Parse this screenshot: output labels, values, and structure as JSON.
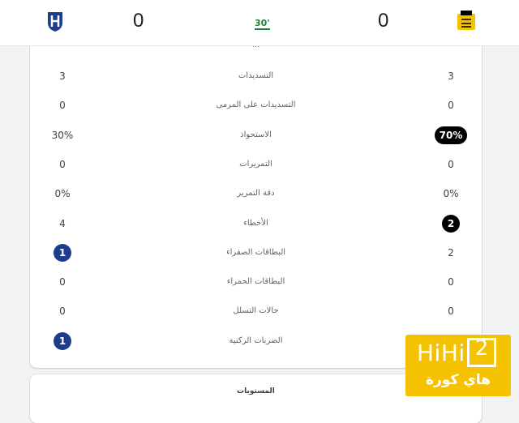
{
  "match": {
    "home_score": "0",
    "away_score": "0",
    "minute": "30'"
  },
  "partial_label": "...",
  "stats": [
    {
      "label": "التسديدات",
      "left": "3",
      "right": "3",
      "left_style": "plain",
      "right_style": "plain"
    },
    {
      "label": "التسديدات على المرمى",
      "left": "0",
      "right": "0",
      "left_style": "plain",
      "right_style": "plain"
    },
    {
      "label": "الاستحواذ",
      "left": "30%",
      "right": "70%",
      "left_style": "plain",
      "right_style": "black"
    },
    {
      "label": "التمريرات",
      "left": "0",
      "right": "0",
      "left_style": "plain",
      "right_style": "plain"
    },
    {
      "label": "دقة التمرير",
      "left": "0%",
      "right": "0%",
      "left_style": "plain",
      "right_style": "plain"
    },
    {
      "label": "الأخطاء",
      "left": "4",
      "right": "2",
      "left_style": "plain",
      "right_style": "black"
    },
    {
      "label": "البطاقات الصفراء",
      "left": "1",
      "right": "2",
      "left_style": "blue",
      "right_style": "plain"
    },
    {
      "label": "البطاقات الحمراء",
      "left": "0",
      "right": "0",
      "left_style": "plain",
      "right_style": "plain"
    },
    {
      "label": "حالات التسلل",
      "left": "0",
      "right": "0",
      "left_style": "plain",
      "right_style": "plain"
    },
    {
      "label": "الضربات الركنية",
      "left": "1",
      "right": "",
      "left_style": "blue",
      "right_style": "plain"
    }
  ],
  "levels_title": "المستويات",
  "watermark": {
    "brand": "HiHi",
    "digit": "2",
    "subtitle": "هاي كورة"
  },
  "colors": {
    "accent_green": "#188038",
    "home_blue": "#1c3d8c",
    "away_gold": "#f4c200",
    "pill_black": "#000000"
  },
  "icons": {
    "home_logo": "al-hilal-crest-icon",
    "away_logo": "al-ittihad-crest-icon"
  }
}
